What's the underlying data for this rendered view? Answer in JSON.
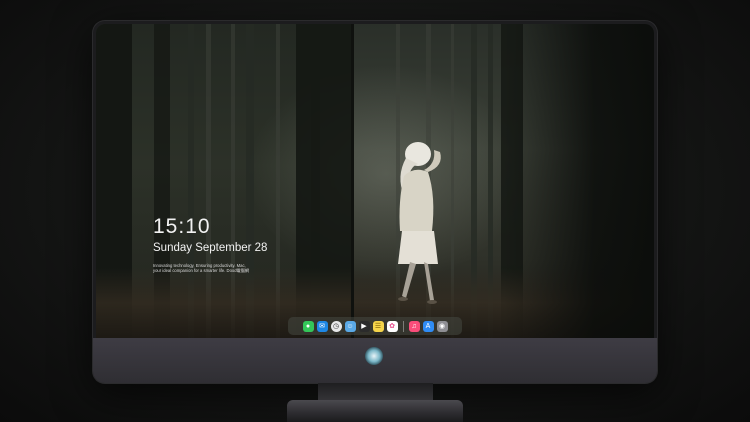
{
  "lockscreen": {
    "time": "15:10",
    "date": "Sunday September 28",
    "tagline_line1": "Innovating technology, Ensuring productivity. Mac,",
    "tagline_line2": "your ideal companion for a smarter life. Dood電腦網"
  },
  "dock": {
    "apps": [
      {
        "icon": "messages-icon",
        "color": "#34c759"
      },
      {
        "icon": "mail-icon",
        "color": "#1e88e5"
      },
      {
        "icon": "clock-icon",
        "color": "#e8e8e8"
      },
      {
        "icon": "finder-icon",
        "color": "#5aa9e6"
      },
      {
        "icon": "clapper-icon",
        "color": "#2b2b2b"
      },
      {
        "icon": "notes-icon",
        "color": "#f5d44a"
      },
      {
        "icon": "photos-icon",
        "color": "#ffffff"
      },
      {
        "icon": "music-icon",
        "color": "#fa4d7a"
      },
      {
        "icon": "app-store-icon",
        "color": "#2f8cf5"
      },
      {
        "icon": "camera-icon",
        "color": "#8e8e93"
      }
    ]
  }
}
